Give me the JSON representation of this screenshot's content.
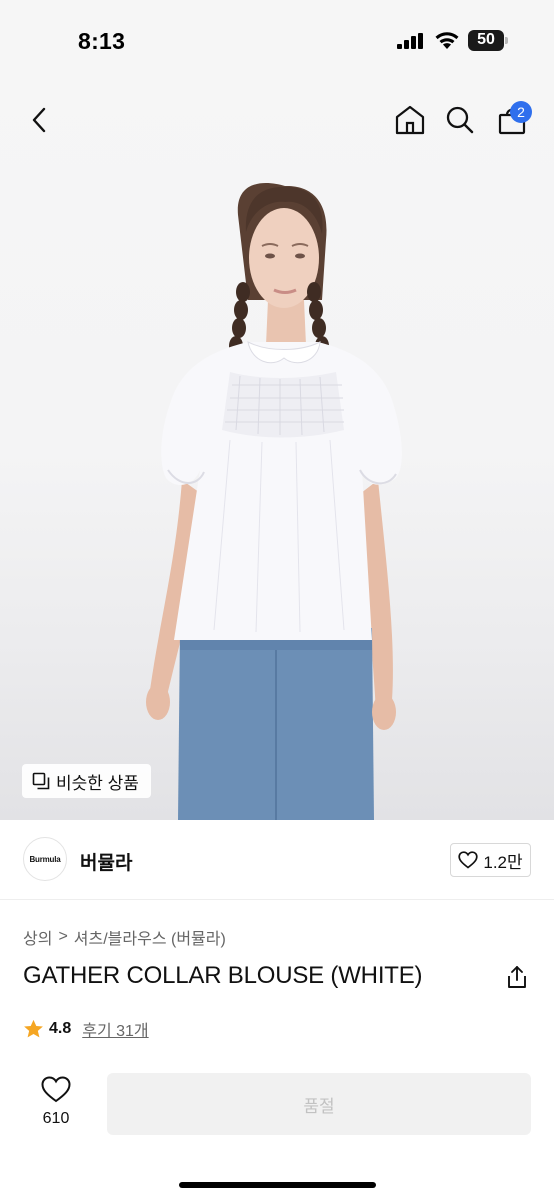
{
  "status_bar": {
    "time": "8:13",
    "battery": "50"
  },
  "nav": {
    "cart_badge": "2"
  },
  "hero": {
    "similar_items_label": "비슷한 상품"
  },
  "brand": {
    "logo_text": "Burmula",
    "name": "버뮬라",
    "like_count": "1.2만"
  },
  "breadcrumb": {
    "category": "상의",
    "separator": ">",
    "subcategory": "셔츠/블라우스 (버뮬라)"
  },
  "product": {
    "title": "GATHER COLLAR BLOUSE (WHITE)",
    "rating": "4.8",
    "review_link": "후기 31개"
  },
  "bottom_bar": {
    "wish_count": "610",
    "soldout_label": "품절"
  },
  "colors": {
    "accent_blue": "#2f6fed",
    "star": "#f5a623",
    "soldout_bg": "#f1f1f1",
    "soldout_text": "#c2c2c2"
  },
  "icons": [
    "back-icon",
    "home-icon",
    "search-icon",
    "cart-icon",
    "similar-items-icon",
    "heart-icon",
    "share-icon",
    "star-icon"
  ]
}
